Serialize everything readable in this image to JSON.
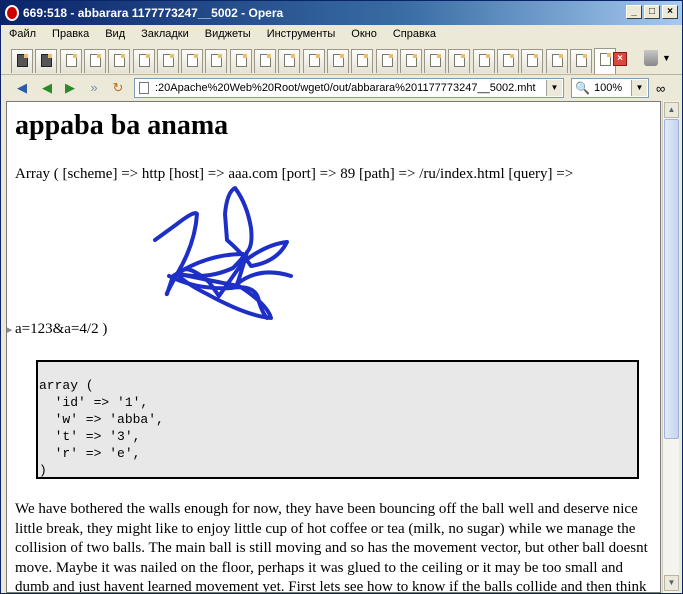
{
  "window": {
    "title": "669:518 - abbarara 1177773247__5002 - Opera"
  },
  "menu": [
    "Файл",
    "Правка",
    "Вид",
    "Закладки",
    "Виджеты",
    "Инструменты",
    "Окно",
    "Справка"
  ],
  "tabs": {
    "count": 25
  },
  "address_bar": {
    "url": ":20Apache%20Web%20Root/wget0/out/abbarara%201177773247__5002.mht"
  },
  "zoom": {
    "value": "100%"
  },
  "page": {
    "title": "appaba ba anama",
    "array_line": "Array ( [scheme] => http [host] => aaa.com [port] => 89 [path] => /ru/index.html [query] =>",
    "array_line2": "a=123&a=4/2 )",
    "code": [
      "array (",
      "  'id' => '1',",
      "  'w' => 'abba',",
      "  't' => '3',",
      "  'r' => 'e',",
      ")"
    ],
    "paragraph": "We have bothered the walls enough for now, they have been bouncing off the ball well and deserve nice little break, they might like to enjoy little cup of hot coffee or tea (milk, no sugar) while we manage the collision of two balls. The main ball is still moving and so has the movement vector, but other ball doesnt move. Maybe it was nailed on the floor, perhaps it was glued to the ceiling or it may be too small and dumb and just havent learned movement yet. First lets see how to know if the balls collide and then think what to"
  },
  "colors": {
    "scribble": "#1e2fc8",
    "titlebar": "#0a246a"
  },
  "icons": [
    "opera-logo-icon",
    "minimize-icon",
    "maximize-icon",
    "close-icon",
    "back-icon",
    "forward-icon",
    "fast-forward-icon",
    "reload-icon",
    "page-icon",
    "dropdown-icon",
    "zoom-icon",
    "trash-icon",
    "tab-close-icon",
    "glasses-icon"
  ]
}
